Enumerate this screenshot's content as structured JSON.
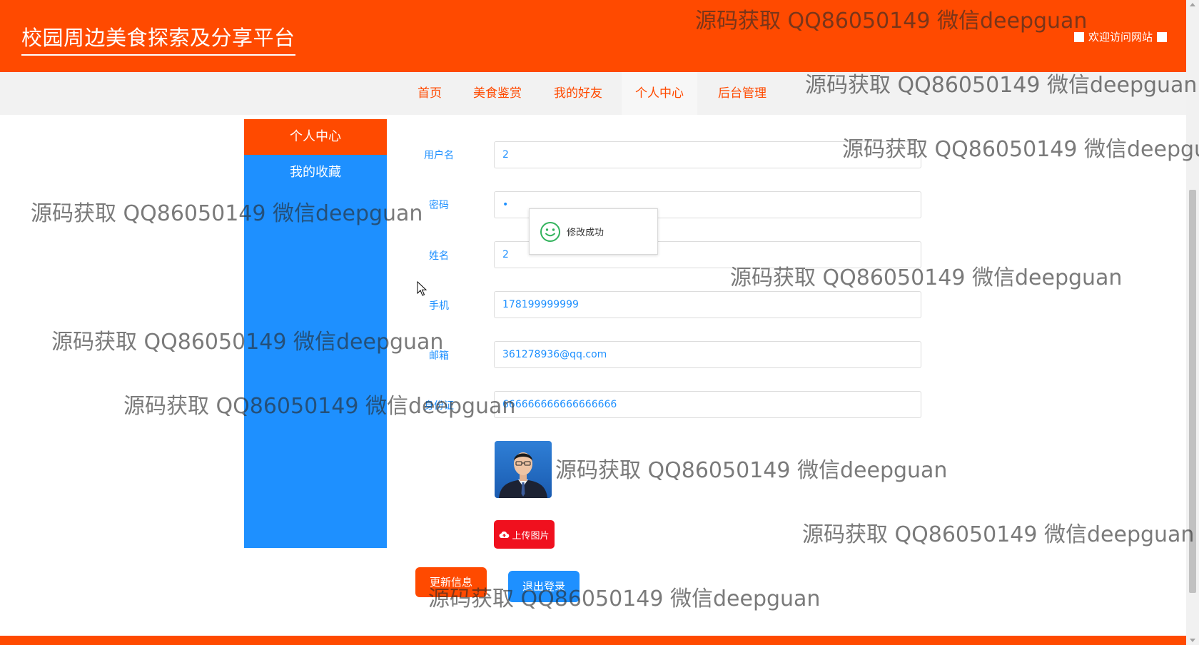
{
  "header": {
    "site_title": "校园周边美食探索及分享平台",
    "welcome": "欢迎访问网站"
  },
  "nav": {
    "items": [
      "首页",
      "美食鉴赏",
      "我的好友",
      "个人中心",
      "后台管理"
    ],
    "active": "个人中心"
  },
  "sidebar": {
    "title": "个人中心",
    "items": [
      "我的收藏"
    ]
  },
  "form": {
    "fields": [
      {
        "label": "用户名",
        "value": "2"
      },
      {
        "label": "密码",
        "value": "•"
      },
      {
        "label": "姓名",
        "value": "2"
      },
      {
        "label": "手机",
        "value": "178199999999"
      },
      {
        "label": "邮箱",
        "value": "361278936@qq.com"
      },
      {
        "label": "身份证",
        "value": "666666666666666666"
      }
    ],
    "upload_label": "上传图片",
    "update_label": "更新信息",
    "logout_label": "退出登录"
  },
  "toast": {
    "message": "修改成功"
  },
  "watermark": "源码获取 QQ86050149 微信deepguan",
  "colors": {
    "brand": "#ff4a00",
    "accent": "#1e90ff",
    "upload": "#f0101e"
  }
}
